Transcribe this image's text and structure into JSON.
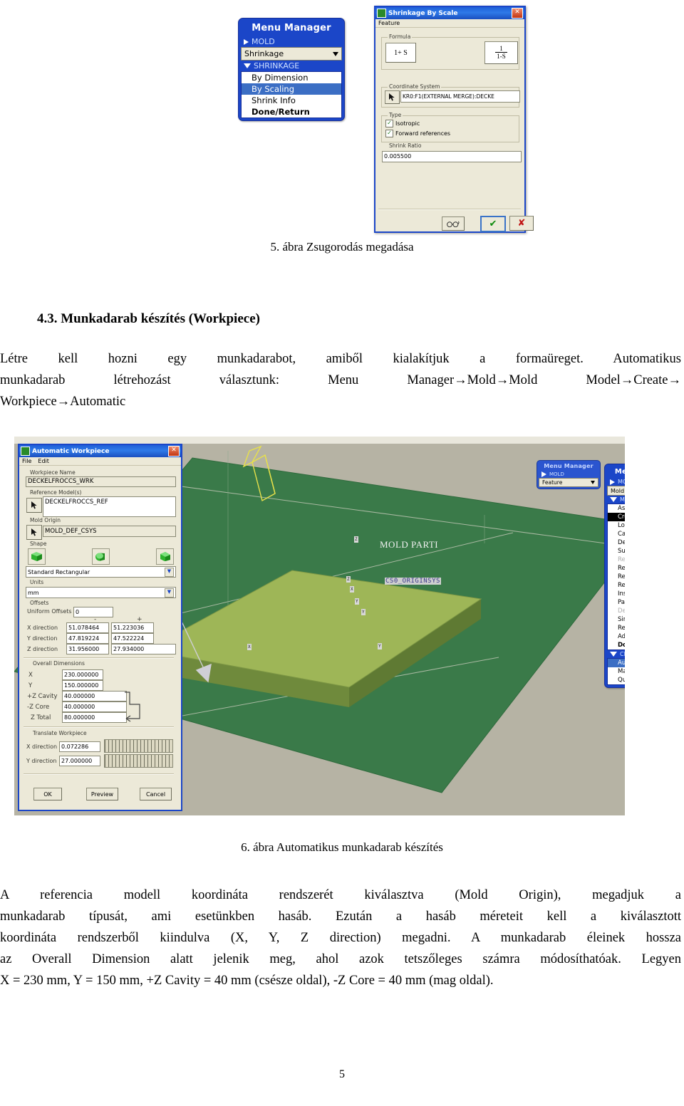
{
  "figure5": {
    "menu_manager": {
      "title": "Menu Manager",
      "head_item": "MOLD",
      "combo_value": "Shrinkage",
      "section_header": "SHRINKAGE",
      "items": [
        {
          "label": "By Dimension",
          "state": "normal"
        },
        {
          "label": "By Scaling",
          "state": "selected"
        },
        {
          "label": "Shrink Info",
          "state": "normal"
        },
        {
          "label": "Done/Return",
          "state": "bold"
        }
      ]
    },
    "dialog": {
      "title": "Shrinkage By Scale",
      "menubar": "Feature",
      "formula_group": "Formula",
      "formula_left": "1+ S",
      "formula_right_num": "1",
      "formula_right_den": "1-S",
      "coordsys_group": "Coordinate System",
      "coordsys_value": "KR0:F1(EXTERNAL MERGE):DECKE",
      "type_group": "Type",
      "checkbox_isotropic": "Isotropic",
      "checkbox_forward": "Forward references",
      "checkbox_mark": "✓",
      "shrink_group": "Shrink Ratio",
      "shrink_value": "0.005500",
      "btn_preview": "glasses-icon",
      "btn_ok": "✔",
      "btn_cancel": "✘",
      "close": "✕"
    },
    "caption": "5. ábra Zsugorodás megadása"
  },
  "section": {
    "heading": "4.3. Munkadarab készítés (Workpiece)",
    "paragraph_line1": "Létre kell hozni egy munkadarabot, amiből kialakítjuk a formaüreget. Automatikus",
    "paragraph_line2": "munkadarab létrehozást választunk: Menu Manager→Mold→Mold Model→Create→",
    "paragraph_line3": "Workpiece→Automatic"
  },
  "figure6": {
    "caption": "6. ábra Automatikus munkadarab készítés",
    "viewport": {
      "model_label": "MOLD PARTI",
      "csys_name": "CS0_ORIGINSYS",
      "axis_labels": [
        "Z",
        "X",
        "Y",
        "X",
        "Y",
        "Z",
        "Y",
        "X"
      ]
    },
    "workpiece_dialog": {
      "title": "Automatic Workpiece",
      "close": "✕",
      "menu_file": "File",
      "menu_edit": "Edit",
      "g_workpiece_name": "Workpiece Name",
      "v_workpiece_name": "DECKELFROCCS_WRK",
      "g_reference_models": "Reference Model(s)",
      "v_reference_models": "DECKELFROCCS_REF",
      "g_mold_origin": "Mold Origin",
      "v_mold_origin": "MOLD_DEF_CSYS",
      "g_shape": "Shape",
      "shape_icons": [
        "box-shape-icon",
        "cylinder-shape-icon",
        "custom-shape-icon"
      ],
      "v_shape_type": "Standard Rectangular",
      "g_units": "Units",
      "v_units": "mm",
      "g_offsets": "Offsets",
      "l_uniform_offsets": "Uniform Offsets",
      "v_uniform_offsets": "0",
      "hdr_minus": "-",
      "hdr_plus": "+",
      "offsets_rows": [
        {
          "label": "X direction",
          "minus": "51.078464",
          "plus": "51.223036"
        },
        {
          "label": "Y direction",
          "minus": "47.819224",
          "plus": "47.522224"
        },
        {
          "label": "Z direction",
          "minus": "31.956000",
          "plus": "27.934000"
        }
      ],
      "g_overall": "Overall Dimensions",
      "overall_rows": [
        {
          "label": "X",
          "value": "230.000000"
        },
        {
          "label": "Y",
          "value": "150.000000"
        },
        {
          "label": "+Z Cavity",
          "value": "40.000000"
        },
        {
          "label": "-Z Core",
          "value": "40.000000"
        },
        {
          "label": "Z Total",
          "value": "80.000000"
        }
      ],
      "g_translate": "Translate Workpiece",
      "translate_rows": [
        {
          "label": "X direction",
          "value": "0.072286"
        },
        {
          "label": "Y direction",
          "value": "27.000000"
        }
      ],
      "btn_ok": "OK",
      "btn_preview": "Preview",
      "btn_cancel": "Cancel"
    },
    "menu_small": {
      "title": "Menu Manager",
      "head_item": "MOLD",
      "combo_value": "Feature"
    },
    "menu_big": {
      "title": "Menu Manager",
      "head_item": "MOLD",
      "combo_value": "Mold Model",
      "section_header": "MOLD MODEL",
      "items": [
        {
          "label": "Assemble",
          "state": "normal"
        },
        {
          "label": "Create",
          "state": "selected-black"
        },
        {
          "label": "Locate RefPart",
          "state": "normal"
        },
        {
          "label": "Catalog",
          "state": "normal"
        },
        {
          "label": "Delete",
          "state": "normal"
        },
        {
          "label": "Suppress",
          "state": "normal"
        },
        {
          "label": "Resume",
          "state": "disabled"
        },
        {
          "label": "Redefine",
          "state": "normal"
        },
        {
          "label": "Reroute",
          "state": "normal"
        },
        {
          "label": "Reorder",
          "state": "normal"
        },
        {
          "label": "Insert Mode",
          "state": "normal"
        },
        {
          "label": "Pattern",
          "state": "normal"
        },
        {
          "label": "Del Pattern",
          "state": "disabled"
        },
        {
          "label": "Simplfd Rep",
          "state": "normal"
        },
        {
          "label": "Reclassify",
          "state": "normal"
        },
        {
          "label": "Adv Utils",
          "state": "normal"
        },
        {
          "label": "Done/Return",
          "state": "bold"
        }
      ],
      "section_header2": "CREATE WORKPI",
      "items2": [
        {
          "label": "Automatic",
          "state": "selected"
        },
        {
          "label": "Manual",
          "state": "normal"
        },
        {
          "label": "Quit",
          "state": "normal"
        }
      ]
    }
  },
  "body_paragraph": {
    "line1": "A referencia modell koordináta rendszerét kiválasztva (Mold Origin), megadjuk a",
    "line2": "munkadarab típusát, ami esetünkben hasáb. Ezután a hasáb méreteit kell a kiválasztott",
    "line3": "koordináta rendszerből kiindulva (X, Y, Z direction) megadni. A munkadarab éleinek hossza",
    "line4": "az Overall Dimension alatt jelenik meg, ahol azok tetszőleges számra módosíthatóak. Legyen",
    "line5": "X = 230 mm, Y = 150 mm, +Z Cavity = 40 mm (csésze oldal), -Z Core = 40 mm (mag oldal)."
  },
  "page_number": "5",
  "colors": {
    "menu_blue": "#1b46c8",
    "select_blue": "#3b6ec4",
    "viewport_bg": "#b6b3a4",
    "slab_green": "#3a7a49",
    "part_green": "#86a648",
    "axis_yellow": "#e8e14a"
  }
}
